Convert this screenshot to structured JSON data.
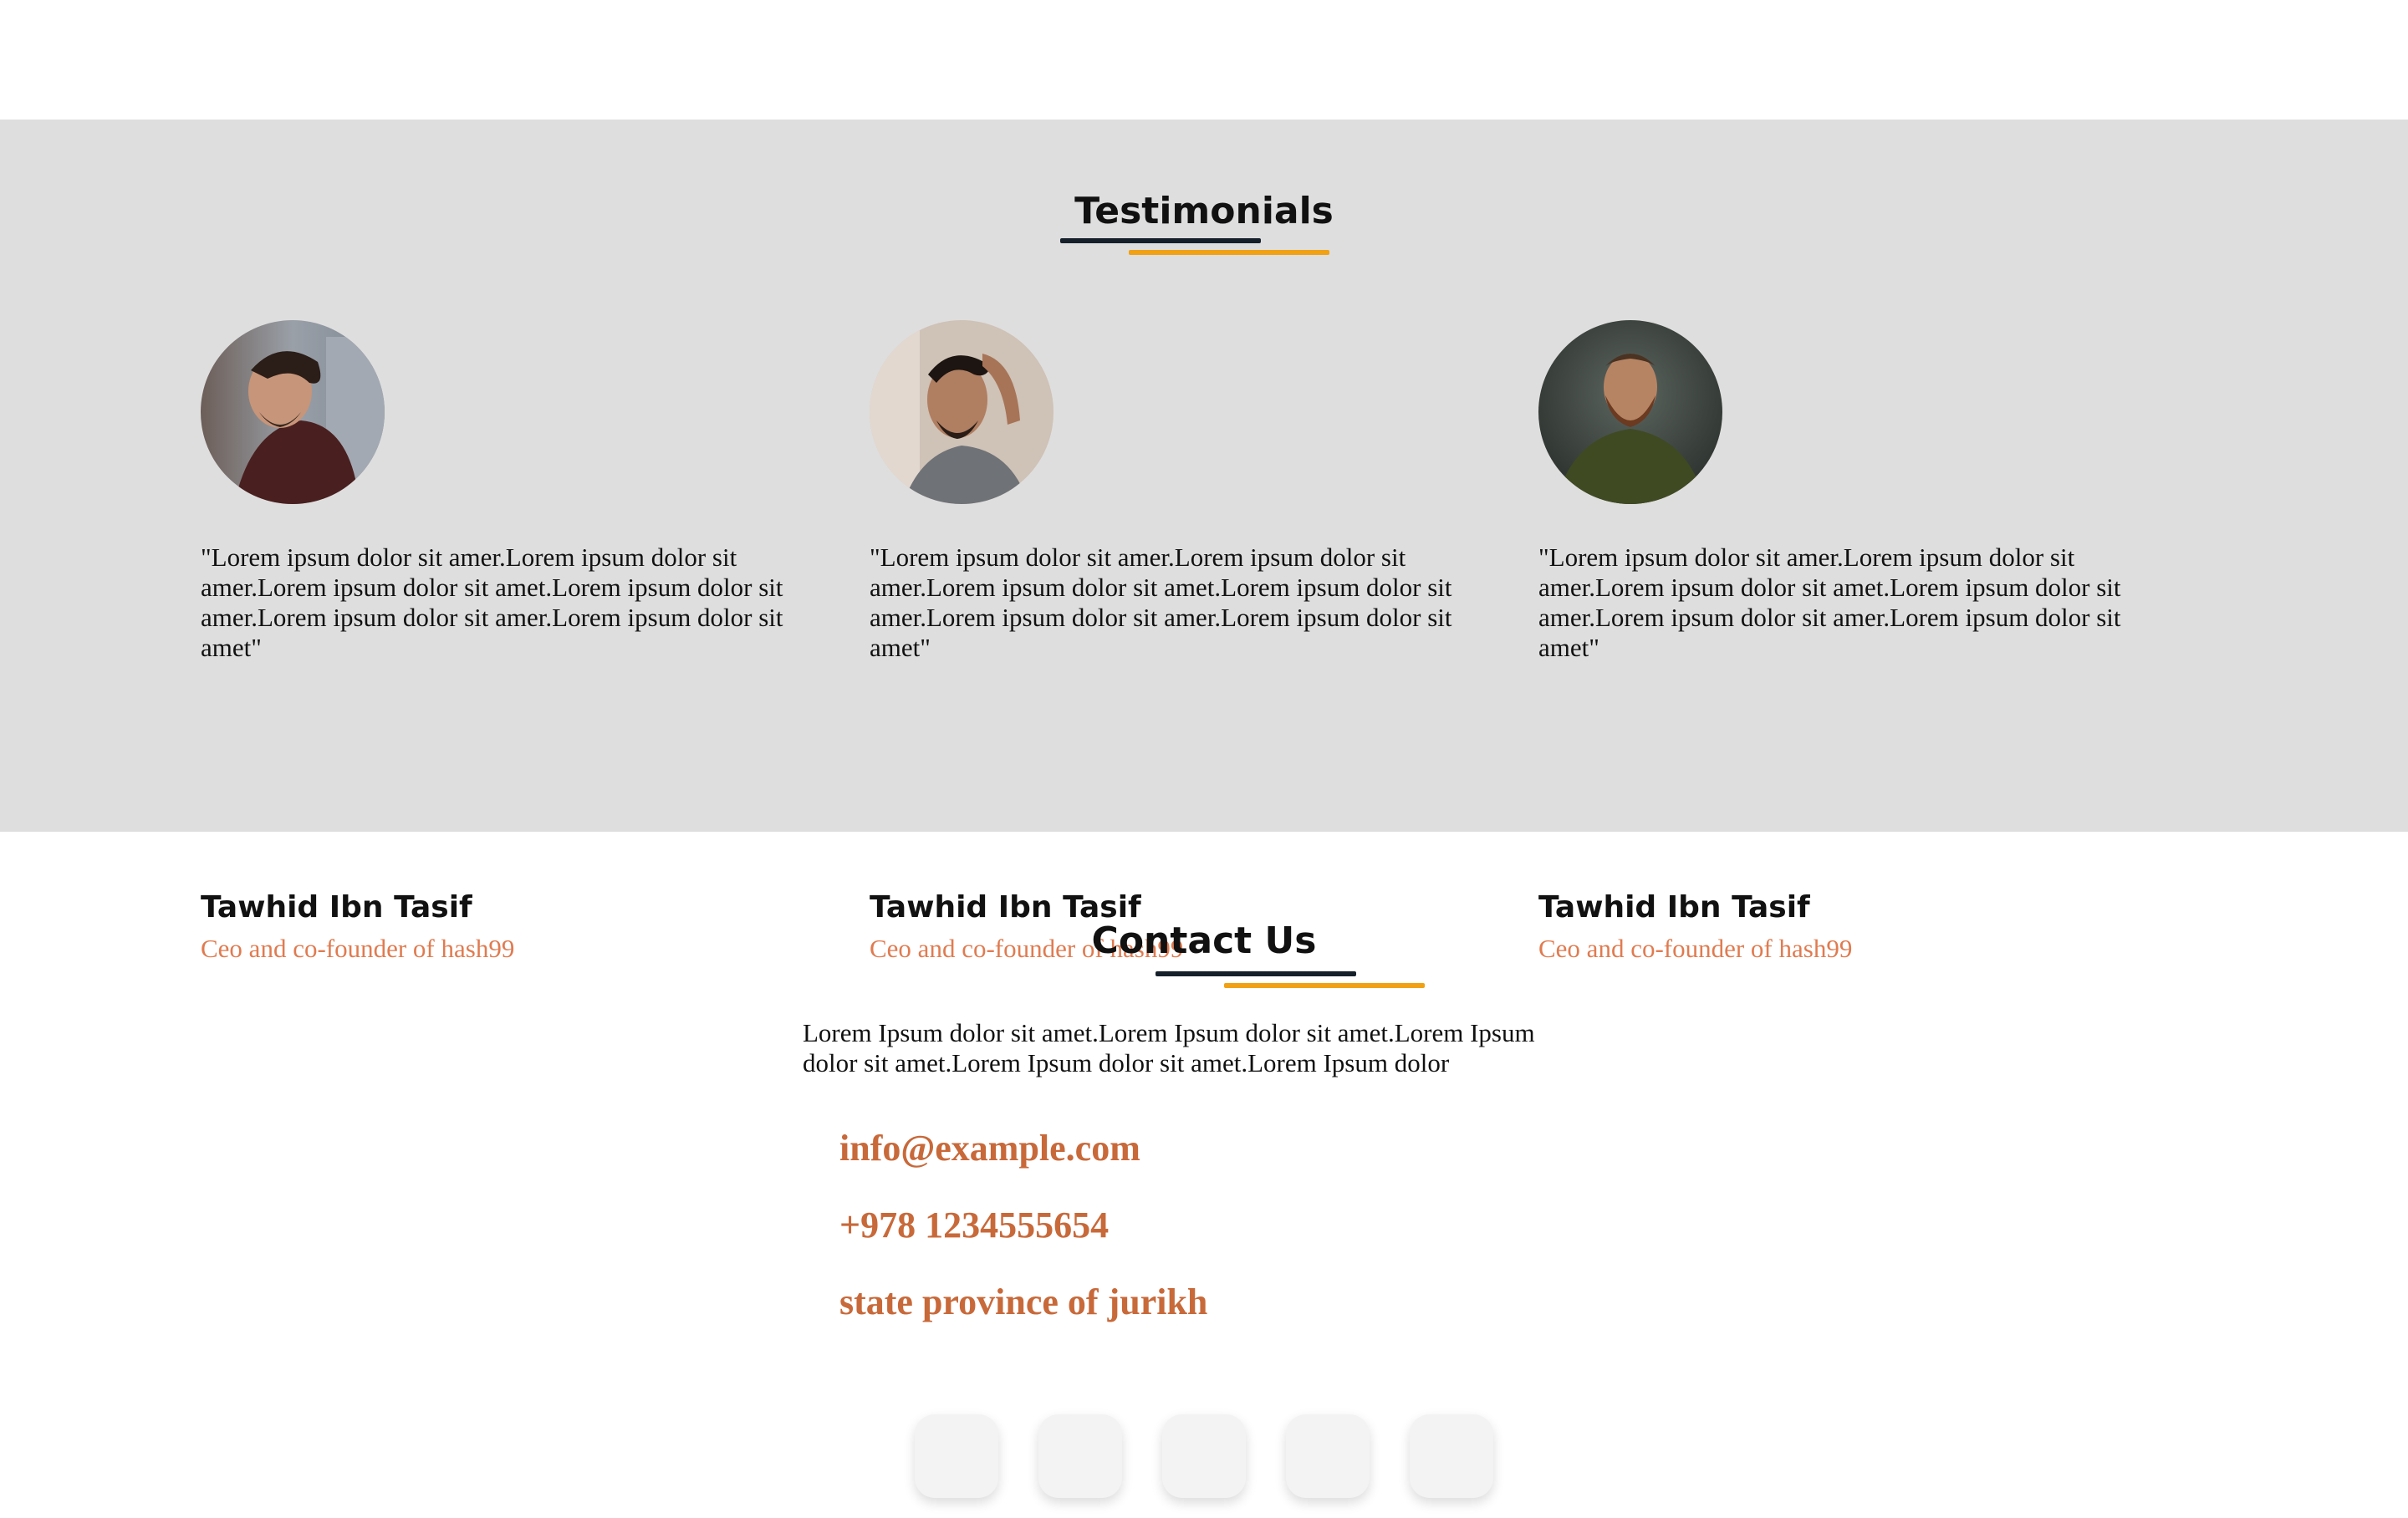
{
  "testimonials": {
    "title": "Testimonials",
    "items": [
      {
        "quote": "\"Lorem ipsum dolor sit amer.Lorem ipsum dolor sit amer.Lorem ipsum dolor sit amet.Lorem ipsum dolor sit amer.Lorem ipsum dolor sit amer.Lorem ipsum dolor sit amet\"",
        "name": "Tawhid Ibn Tasif",
        "role": "Ceo and co-founder of hash99"
      },
      {
        "quote": "\"Lorem ipsum dolor sit amer.Lorem ipsum dolor sit amer.Lorem ipsum dolor sit amet.Lorem ipsum dolor sit amer.Lorem ipsum dolor sit amer.Lorem ipsum dolor sit amet\"",
        "name": "Tawhid Ibn Tasif",
        "role": "Ceo and co-founder of hash99"
      },
      {
        "quote": "\"Lorem ipsum dolor sit amer.Lorem ipsum dolor sit amer.Lorem ipsum dolor sit amet.Lorem ipsum dolor sit amer.Lorem ipsum dolor sit amer.Lorem ipsum dolor sit amet\"",
        "name": "Tawhid Ibn Tasif",
        "role": "Ceo and co-founder of hash99"
      }
    ]
  },
  "contact": {
    "title": "Contact Us",
    "description": "Lorem Ipsum dolor sit amet.Lorem Ipsum dolor sit amet.Lorem Ipsum dolor sit amet.Lorem Ipsum dolor sit amet.Lorem Ipsum dolor",
    "email": "info@example.com",
    "phone": "+978 1234555654",
    "address": "state province of jurikh"
  },
  "colors": {
    "section_bg": "#dedede",
    "accent_orange": "#f0a114",
    "accent_dark": "#15202b",
    "role_text": "#e07b50",
    "contact_text": "#c8693a"
  },
  "social_icons": [
    "social-button-1",
    "social-button-2",
    "social-button-3",
    "social-button-4",
    "social-button-5"
  ]
}
